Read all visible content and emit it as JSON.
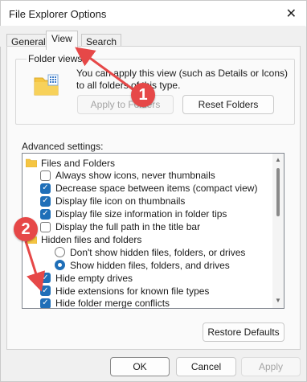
{
  "window": {
    "title": "File Explorer Options",
    "close_glyph": "✕"
  },
  "tabs": [
    {
      "label": "General"
    },
    {
      "label": "View",
      "active": true
    },
    {
      "label": "Search"
    }
  ],
  "folder_views": {
    "group_label": "Folder views",
    "description": "You can apply this view (such as Details or Icons) to all folders of this type.",
    "apply_button": "Apply to Folders",
    "reset_button": "Reset Folders"
  },
  "advanced": {
    "label": "Advanced settings:",
    "items": [
      {
        "kind": "folder",
        "label": "Files and Folders"
      },
      {
        "kind": "checkbox",
        "checked": false,
        "label": "Always show icons, never thumbnails"
      },
      {
        "kind": "checkbox",
        "checked": true,
        "label": "Decrease space between items (compact view)"
      },
      {
        "kind": "checkbox",
        "checked": true,
        "label": "Display file icon on thumbnails"
      },
      {
        "kind": "checkbox",
        "checked": true,
        "label": "Display file size information in folder tips"
      },
      {
        "kind": "checkbox",
        "checked": false,
        "label": "Display the full path in the title bar"
      },
      {
        "kind": "folder",
        "label": "Hidden files and folders"
      },
      {
        "kind": "radio",
        "checked": false,
        "label": "Don't show hidden files, folders, or drives"
      },
      {
        "kind": "radio",
        "checked": true,
        "label": "Show hidden files, folders, and drives"
      },
      {
        "kind": "checkbox",
        "checked": true,
        "label": "Hide empty drives"
      },
      {
        "kind": "checkbox",
        "checked": true,
        "label": "Hide extensions for known file types"
      },
      {
        "kind": "checkbox",
        "checked": true,
        "label": "Hide folder merge conflicts"
      }
    ]
  },
  "restore_defaults": "Restore Defaults",
  "footer": {
    "ok": "OK",
    "cancel": "Cancel",
    "apply": "Apply"
  },
  "annotations": [
    {
      "number": "1"
    },
    {
      "number": "2"
    }
  ],
  "colors": {
    "accent": "#1f6fb8",
    "annotation_red": "#e64848",
    "folder_yellow": "#f5c542"
  }
}
